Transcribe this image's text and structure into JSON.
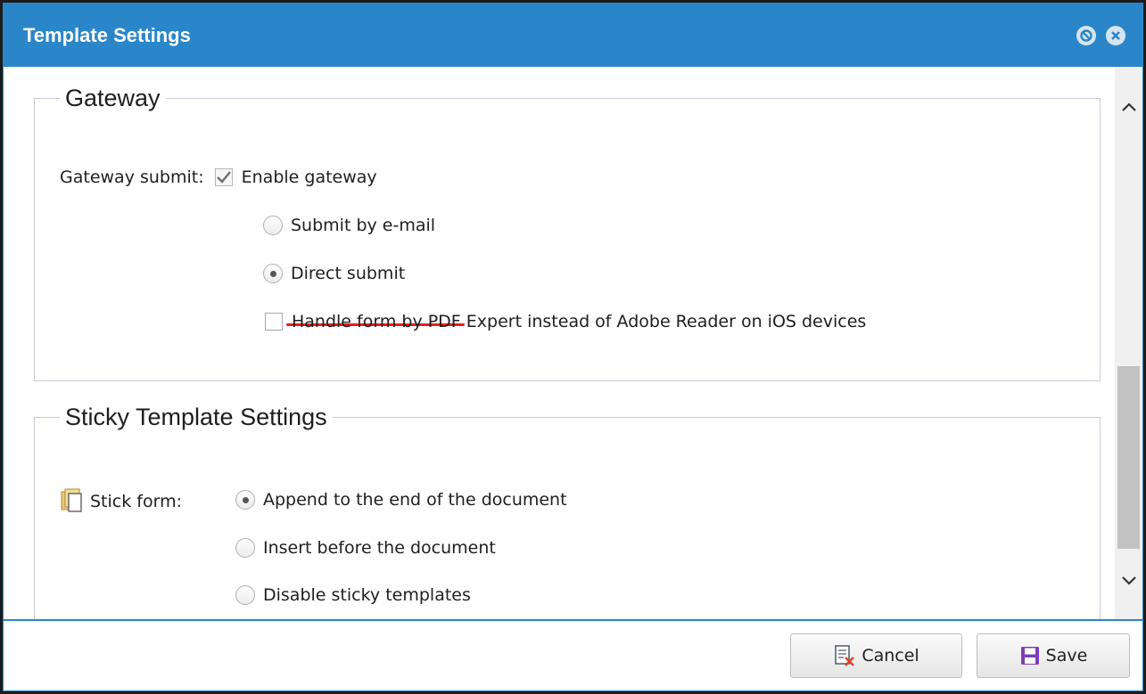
{
  "dialog": {
    "title": "Template Settings"
  },
  "gateway": {
    "legend": "Gateway",
    "submit_label": "Gateway submit:",
    "enable_label": "Enable gateway",
    "enable_checked": true,
    "options": [
      {
        "label": "Submit by e-mail",
        "selected": false
      },
      {
        "label": "Direct submit",
        "selected": true
      }
    ],
    "pdf_expert_label": "Handle form by PDF Expert instead of Adobe Reader on iOS devices",
    "pdf_expert_checked": false
  },
  "sticky": {
    "legend": "Sticky Template Settings",
    "stick_label": "Stick form:",
    "options": [
      {
        "label": "Append to the end of the document",
        "selected": true
      },
      {
        "label": "Insert before the document",
        "selected": false
      },
      {
        "label": "Disable sticky templates",
        "selected": false
      }
    ]
  },
  "footer": {
    "cancel_label": "Cancel",
    "save_label": "Save"
  },
  "icons": {
    "minimize": "minimize-icon",
    "close": "close-icon",
    "stick_form": "documents-icon",
    "cancel": "cancel-document-icon",
    "save": "floppy-disk-icon"
  },
  "colors": {
    "titlebar": "#2a86c8",
    "annotation": "#e81c1c",
    "save_icon": "#7b3fb5",
    "cancel_icon": "#d9452b"
  }
}
